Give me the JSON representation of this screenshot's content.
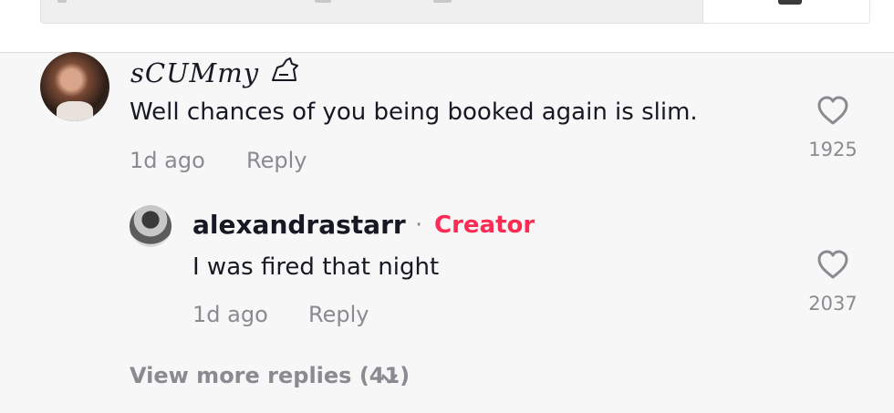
{
  "colors": {
    "background": "#f7f7f7",
    "text_primary": "#161823",
    "text_secondary": "#8a8b91",
    "creator_accent": "#fe2c55"
  },
  "comment": {
    "username": "sCUMmy",
    "text": "Well chances of you being booked again is slim.",
    "time": "1d ago",
    "reply_label": "Reply",
    "likes": "1925",
    "like_icon": "heart-icon",
    "avatar_icon": "user-avatar"
  },
  "reply": {
    "username": "alexandrastarr",
    "separator": "·",
    "badge": "Creator",
    "text": "I was fired that night",
    "time": "1d ago",
    "reply_label": "Reply",
    "likes": "2037",
    "like_icon": "heart-icon",
    "avatar_icon": "user-avatar"
  },
  "view_more": {
    "label": "View more replies (41)",
    "icon": "chevron-down-icon"
  }
}
